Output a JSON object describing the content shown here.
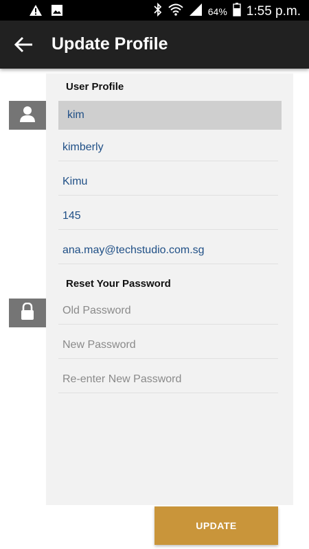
{
  "status_bar": {
    "battery": "64%",
    "time": "1:55 p.m.",
    "icons": [
      "warning-icon",
      "image-icon",
      "bluetooth-icon",
      "wifi-icon",
      "signal-icon",
      "battery-icon"
    ]
  },
  "app_bar": {
    "title": "Update Profile",
    "back_icon": "arrow-left-icon"
  },
  "profile": {
    "section_title": "User Profile",
    "username": "kim",
    "first_name": "kimberly",
    "last_name": "Kimu",
    "number": "145",
    "email": "ana.may@techstudio.com.sg"
  },
  "password": {
    "section_title": "Reset Your Password",
    "old_placeholder": "Old Password",
    "new_placeholder": "New Password",
    "confirm_placeholder": "Re-enter New Password"
  },
  "actions": {
    "update_label": "UPDATE"
  },
  "colors": {
    "app_bar": "#212121",
    "card": "#f2f2f2",
    "field_text": "#1f4f86",
    "button": "#c9953a",
    "side_icon": "#757575"
  }
}
